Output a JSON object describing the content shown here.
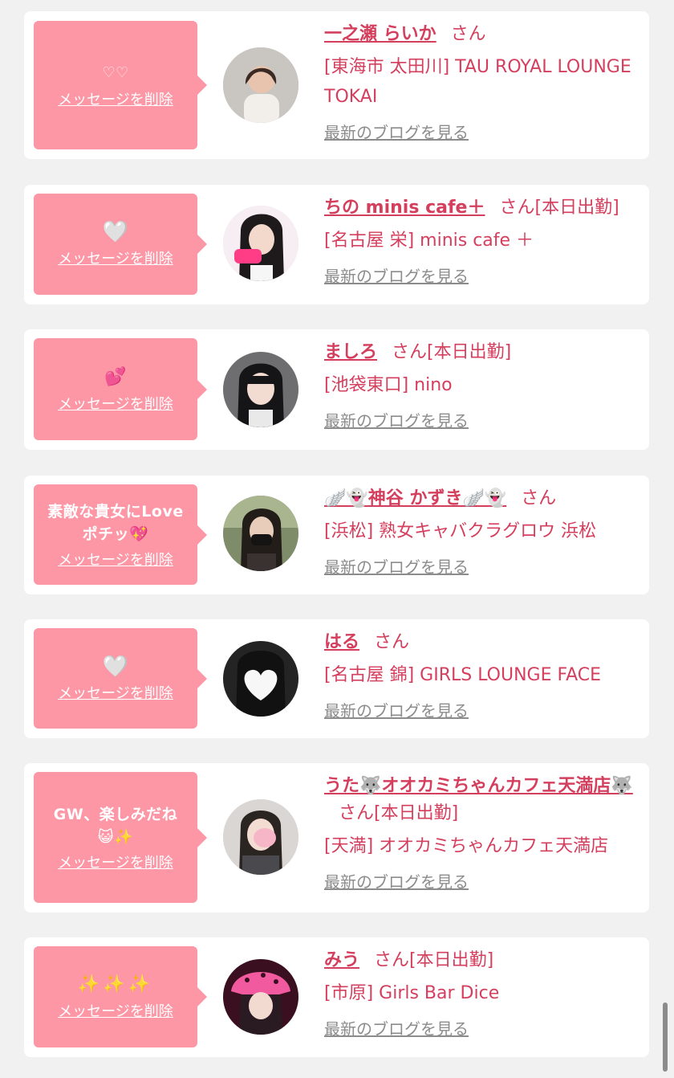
{
  "delete_label": "メッセージを削除",
  "blog_label": "最新のブログを見る",
  "san_label": "さん",
  "cards": [
    {
      "message": "♡♡",
      "name": "一之瀬 らいか",
      "status": "",
      "shop": "[東海市 太田川] TAU ROYAL LOUNGE TOKAI",
      "avatar": "girl-photo-icon"
    },
    {
      "message": "🤍",
      "name": "ちの minis cafe＋",
      "status": "[本日出勤]",
      "shop": "[名古屋 栄] minis cafe ＋",
      "avatar": "girl-photo-icon"
    },
    {
      "message": "💕",
      "name": "ましろ",
      "status": "[本日出勤]",
      "shop": "[池袋東口] nino",
      "avatar": "girl-photo-icon"
    },
    {
      "message": "素敵な貴女にLoveポチッ💖",
      "name": "🪽👻神谷 かずき🪽👻",
      "status": "",
      "shop": "[浜松] 熟女キャバクラグロウ 浜松",
      "avatar": "girl-photo-icon"
    },
    {
      "message": "🤍",
      "name": "はる",
      "status": "",
      "shop": "[名古屋 錦] GIRLS LOUNGE FACE",
      "avatar": "heart-cover-photo-icon"
    },
    {
      "message": "GW、楽しみだね😺✨",
      "name": "うた🐺オオカミちゃんカフェ天満店🐺",
      "status": "[本日出勤]",
      "shop": "[天満] オオカミちゃんカフェ天満店",
      "avatar": "girl-photo-icon"
    },
    {
      "message": "✨✨✨",
      "name": "みう",
      "status": "[本日出勤]",
      "shop": "[市原] Girls Bar Dice",
      "avatar": "girl-photo-icon"
    }
  ]
}
